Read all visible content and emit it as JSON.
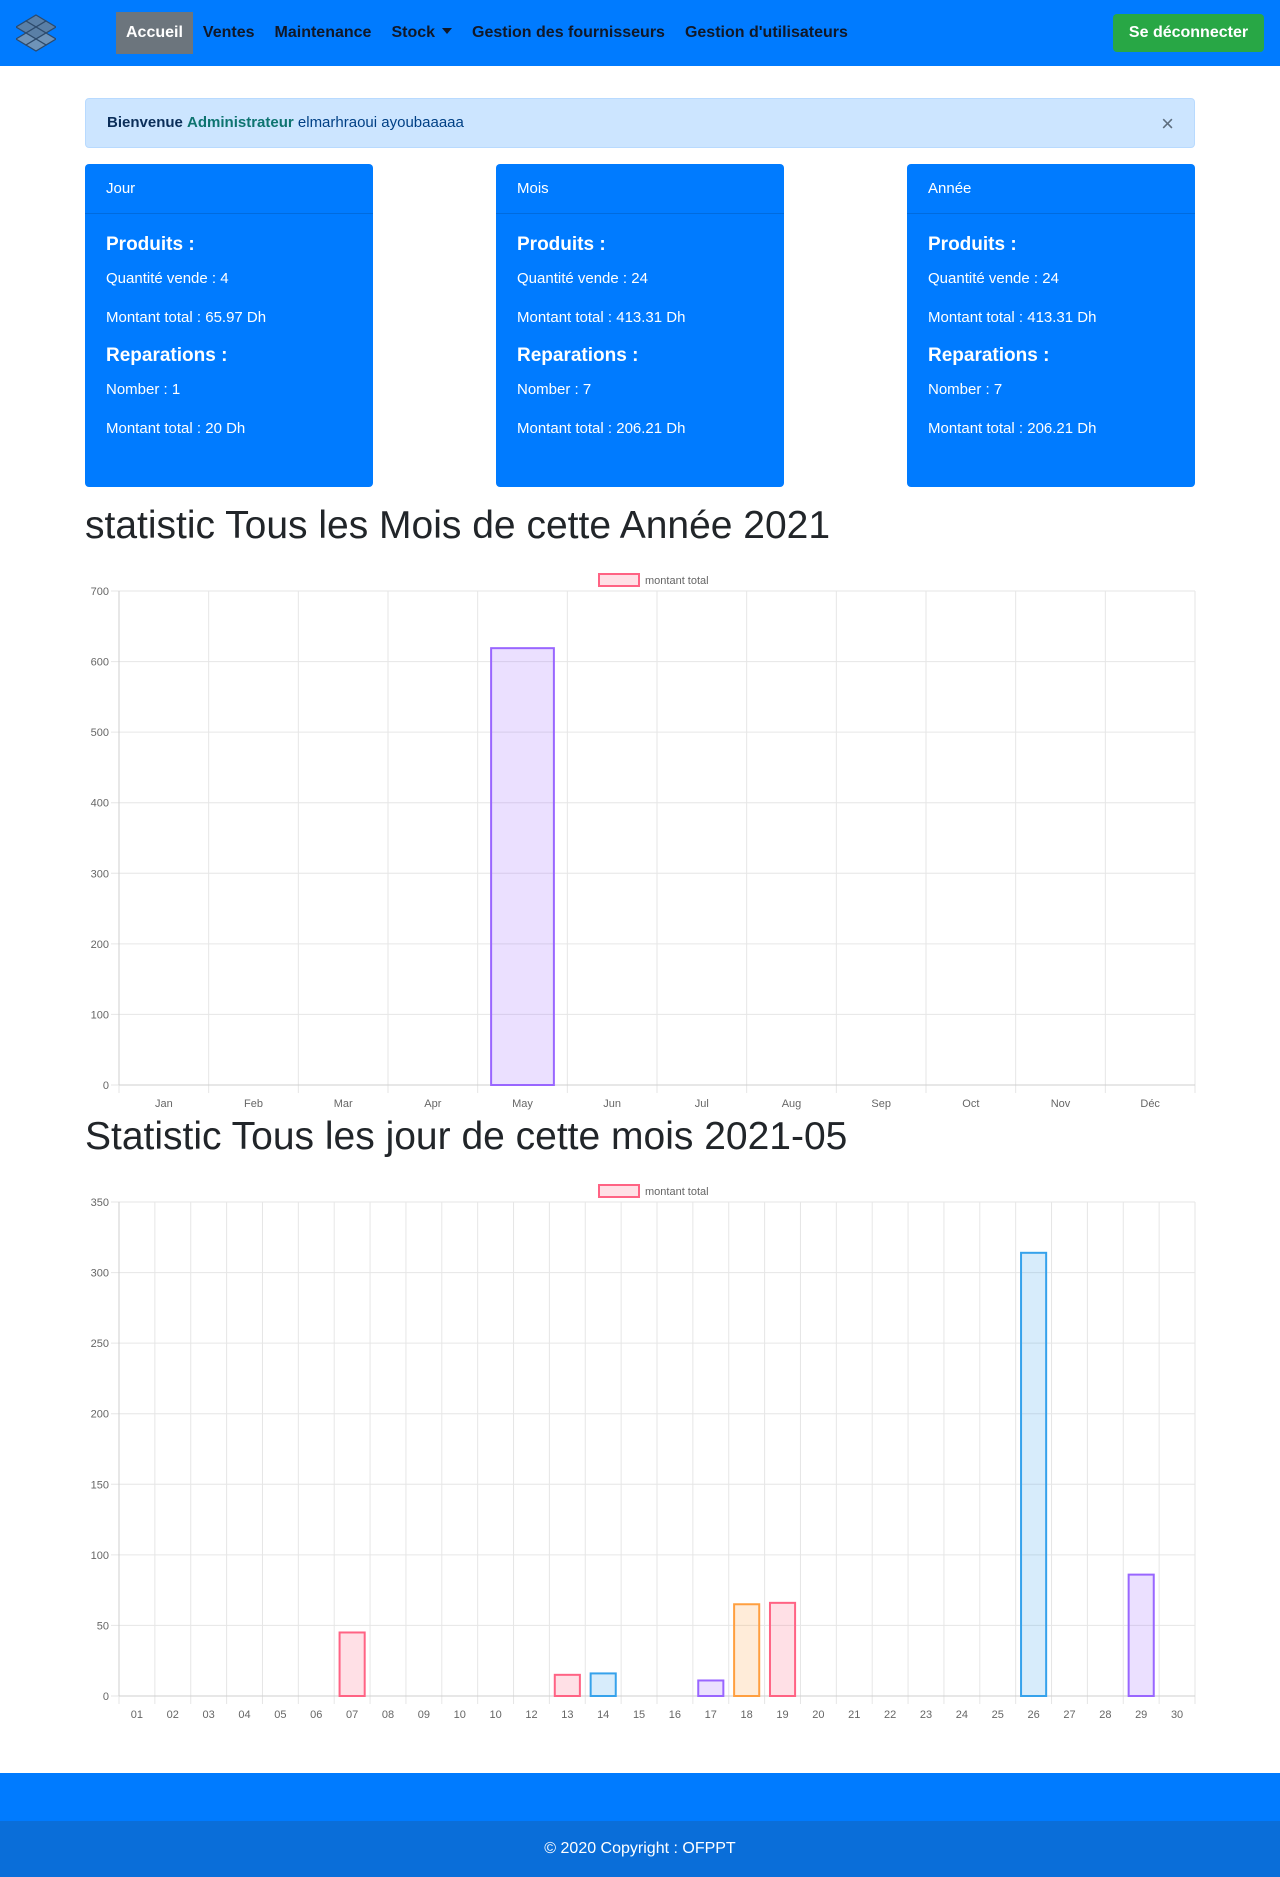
{
  "nav": {
    "items": [
      "Accueil",
      "Ventes",
      "Maintenance",
      "Stock",
      "Gestion des fournisseurs",
      "Gestion d'utilisateurs"
    ],
    "active": "Accueil",
    "logout_label": "Se déconnecter",
    "logo_icon": "stacked-boxes-logo-icon"
  },
  "alert": {
    "greeting": "Bienvenue",
    "role": "Administrateur",
    "username": "elmarhraoui ayoubaaaaa",
    "close_label": "×"
  },
  "cards": [
    {
      "title": "Jour",
      "produits_title": "Produits :",
      "quantite": "Quantité vende : 4",
      "montant_produits": "Montant total : 65.97 Dh",
      "reparations_title": "Reparations :",
      "nombre": "Nomber : 1",
      "montant_reparations": "Montant total : 20 Dh"
    },
    {
      "title": "Mois",
      "produits_title": "Produits :",
      "quantite": "Quantité vende : 24",
      "montant_produits": "Montant total : 413.31 Dh",
      "reparations_title": "Reparations :",
      "nombre": "Nomber : 7",
      "montant_reparations": "Montant total : 206.21 Dh"
    },
    {
      "title": "Année",
      "produits_title": "Produits :",
      "quantite": "Quantité vende : 24",
      "montant_produits": "Montant total : 413.31 Dh",
      "reparations_title": "Reparations :",
      "nombre": "Nomber : 7",
      "montant_reparations": "Montant total : 206.21 Dh"
    }
  ],
  "headings": {
    "monthly": "statistic Tous les Mois de cette Année 2021",
    "daily": "Statistic Tous les jour de cette mois 2021-05"
  },
  "colors": {
    "primary": "#007bff",
    "success": "#28a745",
    "secondary": "#6c757d",
    "footer_dark": "#0a6ed9",
    "bar_red": "#ff6384",
    "bar_blue": "#36a2eb",
    "bar_orange": "#ff9f40",
    "bar_purple": "#9966ff"
  },
  "chart_data": [
    {
      "type": "bar",
      "legend": "montant total",
      "legend_position": "top",
      "grid": true,
      "ylim": [
        0,
        700
      ],
      "yticks": [
        0,
        100,
        200,
        300,
        400,
        500,
        600,
        700
      ],
      "categories": [
        "Jan",
        "Feb",
        "Mar",
        "Apr",
        "May",
        "Jun",
        "Jul",
        "Aug",
        "Sep",
        "Oct",
        "Nov",
        "Déc"
      ],
      "values": [
        0,
        0,
        0,
        0,
        619,
        0,
        0,
        0,
        0,
        0,
        0,
        0
      ],
      "bar_colors": [
        "#ff6384",
        "#36a2eb",
        "#ffce56",
        "#4bc0c0",
        "#9966ff",
        "#ff9f40",
        "#ff6384",
        "#36a2eb",
        "#ffce56",
        "#4bc0c0",
        "#9966ff",
        "#ff9f40"
      ]
    },
    {
      "type": "bar",
      "legend": "montant total",
      "legend_position": "top",
      "grid": true,
      "ylim": [
        0,
        350
      ],
      "yticks": [
        0,
        50,
        100,
        150,
        200,
        250,
        300,
        350
      ],
      "categories": [
        "01",
        "02",
        "03",
        "04",
        "05",
        "06",
        "07",
        "08",
        "09",
        "10",
        "10",
        "12",
        "13",
        "14",
        "15",
        "16",
        "17",
        "18",
        "19",
        "20",
        "21",
        "22",
        "23",
        "24",
        "25",
        "26",
        "27",
        "28",
        "29",
        "30"
      ],
      "values": [
        0,
        0,
        0,
        0,
        0,
        0,
        45,
        0,
        0,
        0,
        0,
        0,
        15,
        16,
        0,
        0,
        11,
        65,
        66,
        0,
        0,
        0,
        0,
        0,
        0,
        314,
        0,
        0,
        86,
        0
      ],
      "bar_colors": [
        "#ff6384",
        "#36a2eb",
        "#ffce56",
        "#4bc0c0",
        "#9966ff",
        "#ff9f40",
        "#ff6384",
        "#36a2eb",
        "#ffce56",
        "#4bc0c0",
        "#9966ff",
        "#ff9f40",
        "#ff6384",
        "#36a2eb",
        "#ffce56",
        "#4bc0c0",
        "#9966ff",
        "#ff9f40",
        "#ff6384",
        "#36a2eb",
        "#ffce56",
        "#4bc0c0",
        "#9966ff",
        "#ff9f40",
        "#ff6384",
        "#36a2eb",
        "#ffce56",
        "#4bc0c0",
        "#9966ff",
        "#ff9f40"
      ]
    }
  ],
  "footer": {
    "copyright": "© 2020 Copyright : OFPPT"
  }
}
